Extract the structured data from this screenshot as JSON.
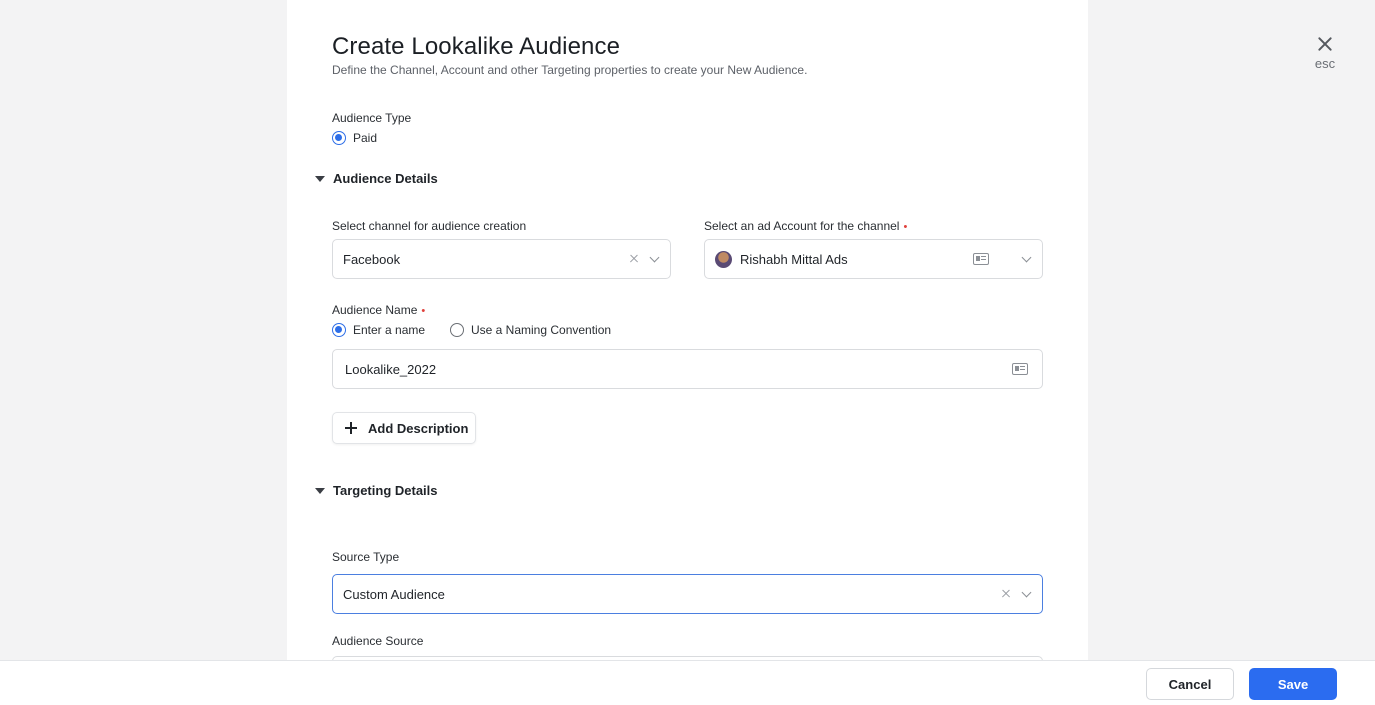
{
  "modal": {
    "title": "Create Lookalike Audience",
    "subtitle": "Define the Channel, Account and other Targeting properties to create your New Audience.",
    "close_label": "esc"
  },
  "audience_type": {
    "label": "Audience Type",
    "option": "Paid",
    "selected": "Paid"
  },
  "audience_details": {
    "heading": "Audience Details",
    "channel": {
      "label": "Select channel for audience creation",
      "value": "Facebook"
    },
    "account": {
      "label": "Select an ad Account for the channel",
      "value": "Rishabh Mittal Ads"
    },
    "name": {
      "label": "Audience Name",
      "option_enter": "Enter a name",
      "option_convention": "Use a Naming Convention",
      "selected": "Enter a name",
      "value": "Lookalike_2022"
    },
    "add_description_label": "Add Description"
  },
  "targeting_details": {
    "heading": "Targeting Details",
    "source_type": {
      "label": "Source Type",
      "value": "Custom Audience"
    },
    "audience_source": {
      "label": "Audience Source"
    }
  },
  "footer": {
    "cancel_label": "Cancel",
    "save_label": "Save"
  },
  "colors": {
    "accent": "#2b6cf0",
    "required": "#e0413c",
    "background": "#f3f3f4"
  },
  "icons": [
    "close-icon",
    "caret-down-icon",
    "clear-icon",
    "chevron-down-icon",
    "id-card-icon",
    "plus-icon",
    "avatar"
  ]
}
